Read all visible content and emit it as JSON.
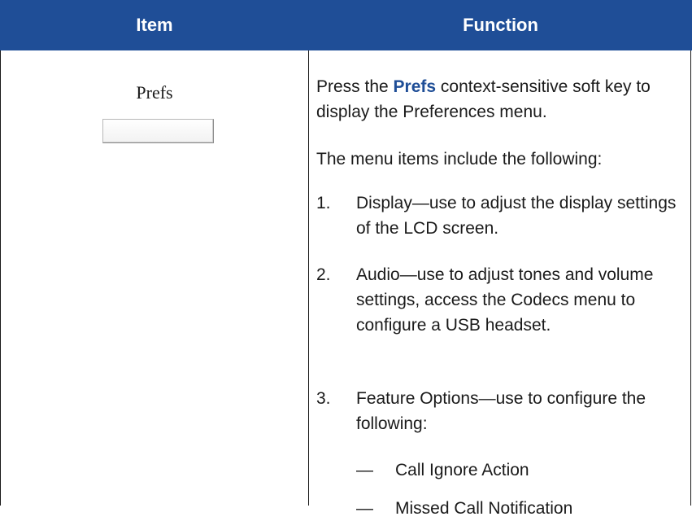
{
  "table": {
    "headers": {
      "item": "Item",
      "function": "Function"
    },
    "row": {
      "item_label": "Prefs",
      "intro": {
        "prefix": "Press the ",
        "key": "Prefs",
        "suffix": " context-sensitive soft key to display the Preferences menu."
      },
      "menu_intro": "The menu items include the following:",
      "list": [
        {
          "number": "1.",
          "text": "Display—use to adjust the display settings of the LCD screen."
        },
        {
          "number": "2.",
          "text": "Audio—use to adjust tones and volume settings, access the Codecs menu to configure a USB headset."
        },
        {
          "number": "3.",
          "text": "Feature Options—use to configure the following:"
        }
      ],
      "sublist": [
        {
          "dash": "—",
          "text": "Call Ignore Action"
        },
        {
          "dash": "—",
          "text": "Missed Call Notification"
        }
      ]
    }
  },
  "colors": {
    "header_bg": "#1f4e97",
    "header_text": "#ffffff",
    "key_text": "#1f4e97"
  }
}
